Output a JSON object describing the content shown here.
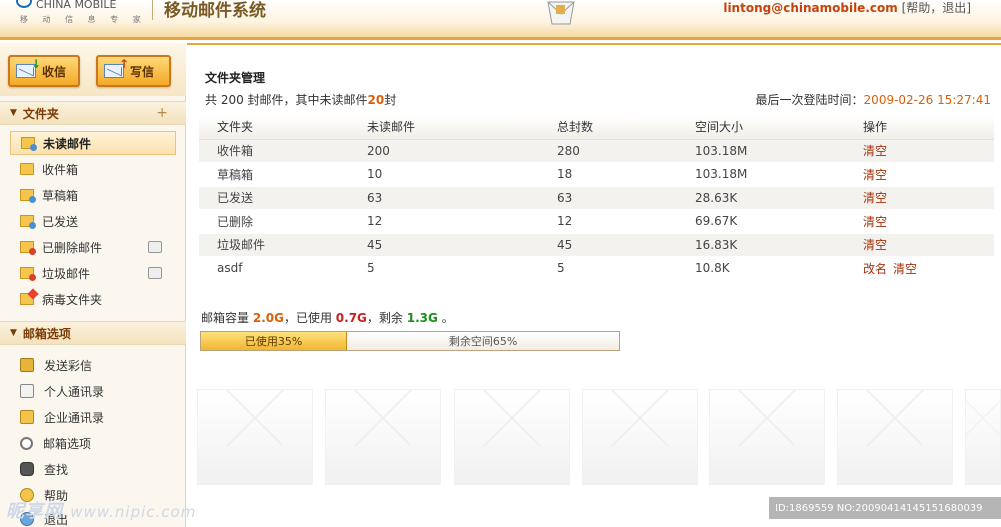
{
  "header": {
    "logo_en": "CHINA MOBILE",
    "logo_cn": "移 动 信 息 专 家",
    "system_title": "移动邮件系统",
    "user_email": "lintong@chinamobile.com",
    "link_open": "[",
    "help_label": "帮助",
    "sep": "，",
    "logout_label": "退出",
    "link_close": "]"
  },
  "sidebar": {
    "receive_label": "收信",
    "write_label": "写信",
    "folders_header": "文件夹",
    "add_symbol": "+",
    "folders": [
      {
        "label": "未读邮件"
      },
      {
        "label": "收件箱"
      },
      {
        "label": "草稿箱"
      },
      {
        "label": "已发送"
      },
      {
        "label": "已删除邮件"
      },
      {
        "label": "垃圾邮件"
      },
      {
        "label": "病毒文件夹"
      }
    ],
    "options_header": "邮箱选项",
    "options": [
      {
        "label": "发送彩信"
      },
      {
        "label": "个人通讯录"
      },
      {
        "label": "企业通讯录"
      },
      {
        "label": "邮箱选项"
      },
      {
        "label": "查找"
      },
      {
        "label": "帮助"
      },
      {
        "label": "退出"
      }
    ]
  },
  "main": {
    "title": "文件夹管理",
    "summary_prefix": "共 200 封邮件，其中未读邮件",
    "summary_unread": "20",
    "summary_suffix": "封",
    "last_login_label": "最后一次登陆时间：",
    "last_login_time": "2009-02-26 15:27:41",
    "columns": [
      "文件夹",
      "未读邮件",
      "总封数",
      "空间大小",
      "操作"
    ],
    "rows": [
      {
        "name": "收件箱",
        "unread": "200",
        "total": "280",
        "size": "103.18M",
        "op1": "清空",
        "op2": ""
      },
      {
        "name": "草稿箱",
        "unread": "10",
        "total": "18",
        "size": "103.18M",
        "op1": "清空",
        "op2": ""
      },
      {
        "name": "已发送",
        "unread": "63",
        "total": "63",
        "size": "28.63K",
        "op1": "清空",
        "op2": ""
      },
      {
        "name": "已删除",
        "unread": "12",
        "total": "12",
        "size": "69.67K",
        "op1": "清空",
        "op2": ""
      },
      {
        "name": "垃圾邮件",
        "unread": "45",
        "total": "45",
        "size": "16.83K",
        "op1": "清空",
        "op2": ""
      },
      {
        "name": "asdf",
        "unread": "5",
        "total": "5",
        "size": "10.8K",
        "op1": "改名",
        "op2": "清空"
      }
    ],
    "quota_prefix": "邮箱容量",
    "quota_capacity": "2.0G",
    "quota_mid1": "，已使用",
    "quota_used": "0.7G",
    "quota_mid2": "，剩余",
    "quota_left": "1.3G",
    "quota_end": "。",
    "bar_used_label": "已使用35%",
    "bar_free_label": "剩余空间65%",
    "used_fraction": 0.35
  },
  "footer": {
    "watermark_cn": "昵享网",
    "watermark_url": "www.nipic.com",
    "id_text": "ID:1869559 NO:20090414145151680039"
  },
  "colors": {
    "accent": "#e9a53c",
    "highlight": "#d9600b",
    "used": "#c81f1f",
    "free": "#1c8f1c",
    "link": "#a3330c"
  }
}
